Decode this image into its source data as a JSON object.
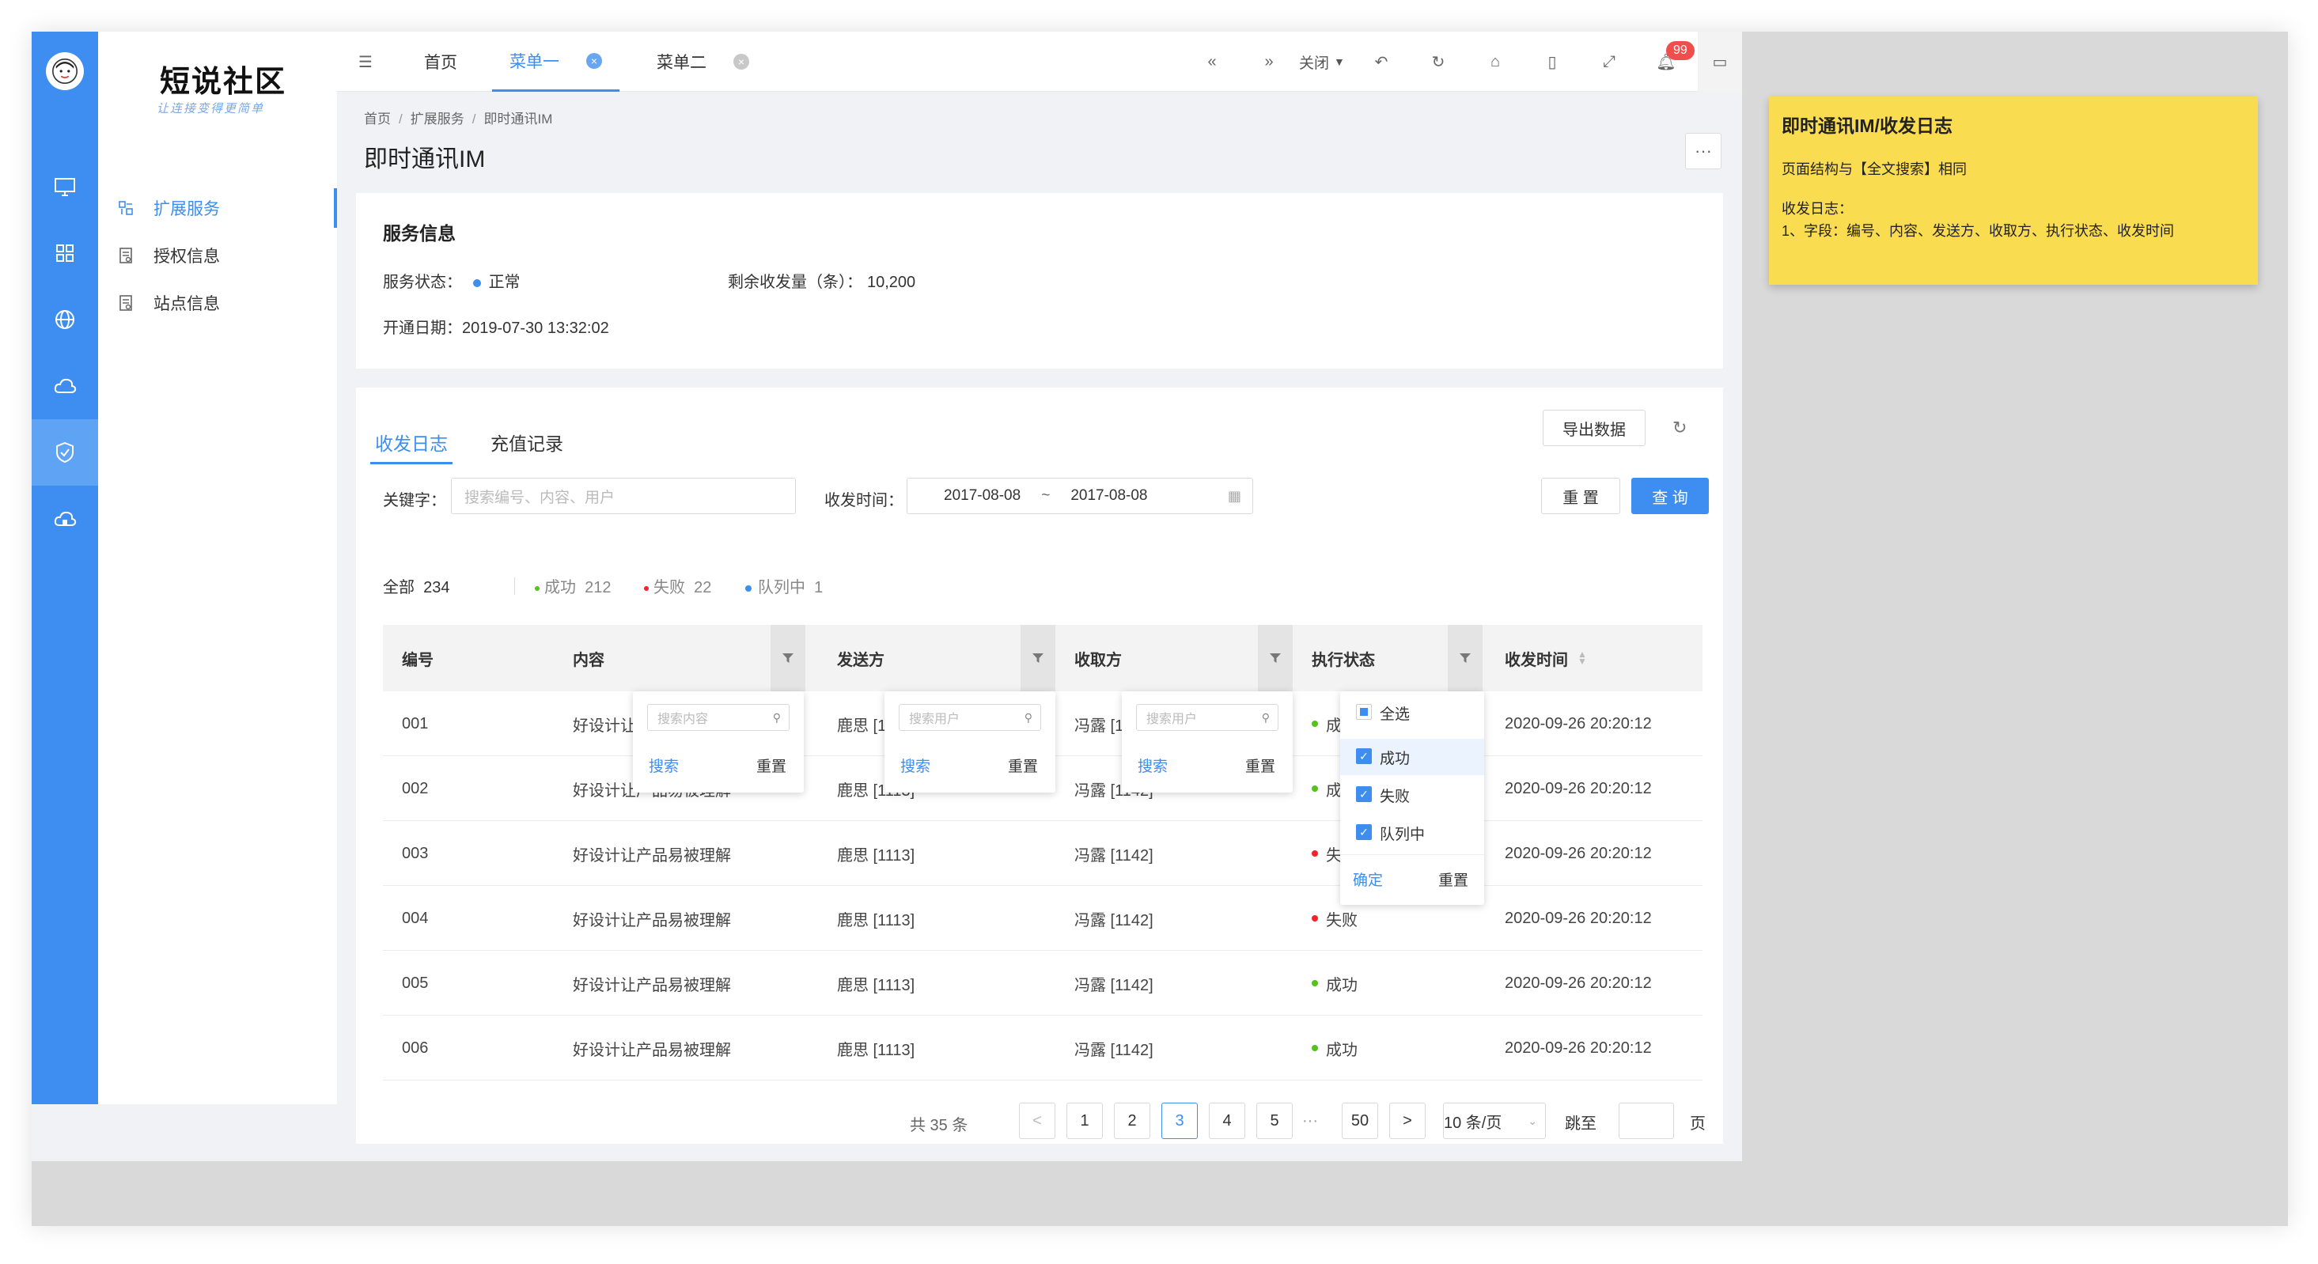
{
  "brand": {
    "name": "短说社区",
    "tagline": "让连接变得更简单"
  },
  "sidebar": {
    "items": [
      {
        "label": "扩展服务",
        "active": true
      },
      {
        "label": "授权信息",
        "active": false
      },
      {
        "label": "站点信息",
        "active": false
      }
    ]
  },
  "rail_icons": [
    "monitor-icon",
    "grid-icon",
    "globe-icon",
    "cloud-icon",
    "shield-check-icon",
    "cloud-home-icon"
  ],
  "tabs": [
    {
      "label": "首页",
      "active": false
    },
    {
      "label": "菜单一",
      "active": true
    },
    {
      "label": "菜单二",
      "active": false
    }
  ],
  "toolbar": {
    "close_label": "关闭",
    "notification_count": "99"
  },
  "breadcrumb": [
    "首页",
    "扩展服务",
    "即时通讯IM"
  ],
  "page": {
    "title": "即时通讯IM",
    "more": "···"
  },
  "service": {
    "heading": "服务信息",
    "status_label": "服务状态：",
    "status_value": "正常",
    "remaining_label": "剩余收发量（条）：",
    "remaining_value": "10,200",
    "opened_label": "开通日期：",
    "opened_value": "2019-07-30 13:32:02"
  },
  "log": {
    "tabs": [
      "收发日志",
      "充值记录"
    ],
    "export_label": "导出数据",
    "keyword_label": "关键字：",
    "keyword_placeholder": "搜索编号、内容、用户",
    "time_label": "收发时间：",
    "date_from": "2017-08-08",
    "date_sep": "~",
    "date_to": "2017-08-08",
    "reset_label": "重 置",
    "query_label": "查 询",
    "summary": {
      "all_label": "全部",
      "all_count": "234",
      "success_label": "成功",
      "success_count": "212",
      "fail_label": "失败",
      "fail_count": "22",
      "queue_label": "队列中",
      "queue_count": "1"
    },
    "columns": [
      "编号",
      "内容",
      "发送方",
      "收取方",
      "执行状态",
      "收发时间"
    ],
    "rows": [
      {
        "id": "001",
        "content": "好设计让产品易被理解",
        "sender": "鹿思 [1113]",
        "receiver": "冯露 [1142]",
        "status": "成功",
        "time": "2020-09-26 20:20:12"
      },
      {
        "id": "002",
        "content": "好设计让产品易被理解",
        "sender": "鹿思 [1113]",
        "receiver": "冯露 [1142]",
        "status": "成功",
        "time": "2020-09-26 20:20:12"
      },
      {
        "id": "003",
        "content": "好设计让产品易被理解",
        "sender": "鹿思 [1113]",
        "receiver": "冯露 [1142]",
        "status": "失败",
        "time": "2020-09-26 20:20:12"
      },
      {
        "id": "004",
        "content": "好设计让产品易被理解",
        "sender": "鹿思 [1113]",
        "receiver": "冯露 [1142]",
        "status": "失败",
        "time": "2020-09-26 20:20:12"
      },
      {
        "id": "005",
        "content": "好设计让产品易被理解",
        "sender": "鹿思 [1113]",
        "receiver": "冯露 [1142]",
        "status": "成功",
        "time": "2020-09-26 20:20:12"
      },
      {
        "id": "006",
        "content": "好设计让产品易被理解",
        "sender": "鹿思 [1113]",
        "receiver": "冯露 [1142]",
        "status": "成功",
        "time": "2020-09-26 20:20:12"
      }
    ],
    "filters": {
      "content_placeholder": "搜索内容",
      "user_placeholder": "搜索用户",
      "search_label": "搜索",
      "reset_label": "重置",
      "status_all": "全选",
      "status_options": [
        "成功",
        "失败",
        "队列中"
      ],
      "confirm_label": "确定"
    },
    "pagination": {
      "total": "共 35 条",
      "prev": "<",
      "pages": [
        "1",
        "2",
        "3",
        "4",
        "5"
      ],
      "current": "3",
      "ellipsis": "···",
      "last": "50",
      "next": ">",
      "page_size": "10 条/页",
      "jump_label": "跳至",
      "page_unit": "页"
    }
  },
  "note": {
    "title": "即时通讯IM/收发日志",
    "line1": "页面结构与【全文搜索】相同",
    "line2": "收发日志：",
    "line3": "1、字段：编号、内容、发送方、收取方、执行状态、收发时间"
  },
  "colors": {
    "primary": "#3d8ef0",
    "success": "#52c41a",
    "fail": "#f5222d",
    "queue": "#3d8ef0",
    "note": "#fadc50"
  }
}
